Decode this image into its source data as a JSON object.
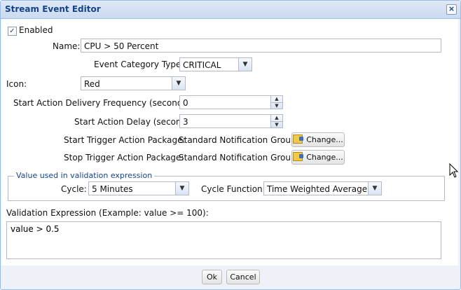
{
  "dialog": {
    "title": "Stream Event Editor"
  },
  "enabled": {
    "label": "Enabled",
    "checked": true
  },
  "name": {
    "label": "Name:",
    "value": "CPU > 50 Percent"
  },
  "event_category_type": {
    "label": "Event Category Type:",
    "value": "CRITICAL"
  },
  "icon": {
    "label": "Icon:",
    "value": "Red"
  },
  "start_action_delivery_frequency": {
    "label": "Start Action Delivery Frequency (seconds):",
    "value": "0"
  },
  "start_action_delay": {
    "label": "Start Action Delay (seconds):",
    "value": "3"
  },
  "start_trigger_action_package": {
    "label": "Start Trigger Action Package:",
    "value": "Standard Notification Group",
    "button": "Change..."
  },
  "stop_trigger_action_package": {
    "label": "Stop Trigger Action Package:",
    "value": "Standard Notification Group",
    "button": "Change..."
  },
  "validation_fieldset": {
    "legend": "Value used in validation expression",
    "cycle": {
      "label": "Cycle:",
      "value": "5 Minutes"
    },
    "cycle_function": {
      "label": "Cycle Function:",
      "value": "Time Weighted Average"
    }
  },
  "validation_expression": {
    "label": "Validation Expression (Example: value >= 100):",
    "value": "value > 0.5"
  },
  "footer": {
    "ok": "Ok",
    "cancel": "Cancel"
  },
  "colors": {
    "title_text": "#15428b",
    "border": "#99bbe8",
    "header_bg": "#dfe9f6"
  },
  "icons": {
    "close": "close-icon",
    "change": "edit-icon",
    "checkbox": "check-icon"
  }
}
